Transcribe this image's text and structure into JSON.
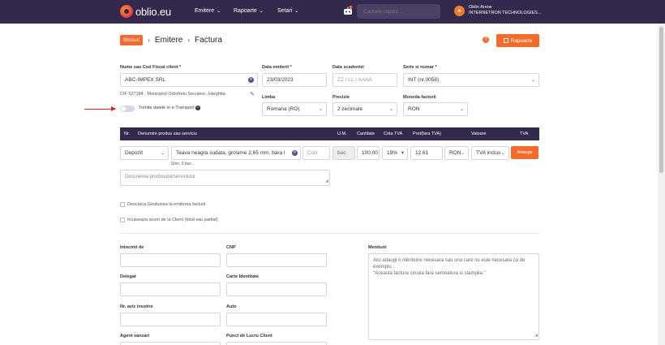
{
  "nav": {
    "logo_text": "oblio.eu",
    "menu": [
      {
        "label": "Emitere"
      },
      {
        "label": "Rapoarte"
      },
      {
        "label": "Setari"
      }
    ],
    "search_placeholder": "Cautare rapida ...",
    "user_name": "Oblio Arrow",
    "user_company": "INTERNETRON TECHNOLOGIES...",
    "avatar_icon": "user-icon"
  },
  "breadcrumb": {
    "badge": "Stocuri",
    "items": [
      "Emitere",
      "Factura"
    ]
  },
  "header_actions": {
    "rapoarte_label": "Rapoarte"
  },
  "client": {
    "label": "Nume sau Cod Fiscal client *",
    "value": "ABC-IMPEX SRL",
    "details": "CIF 527184 , Municipiul Odorheiu Secuiesc, Harghita"
  },
  "dates": {
    "emitere_label": "Data emiterii *",
    "emitere_value": "23/03/2023",
    "scadenta_label": "Data scadentei",
    "scadenta_placeholder": "ZZ / LL / AAAA"
  },
  "series": {
    "label": "Serie si numar *",
    "value": "INT (nr.0058)"
  },
  "etransport": {
    "label": "Trimite datele in e-Transport"
  },
  "language": {
    "label": "Limba",
    "value": "Romana (RO)"
  },
  "precision": {
    "label": "Precizie",
    "value": "2 zecimale"
  },
  "currency": {
    "label": "Moneda facturii",
    "value": "RON"
  },
  "products_table": {
    "headers": [
      "Nr.",
      "Denumire produs sau serviciu",
      "U.M.",
      "Cantitate",
      "Cota TVA",
      "Pret(fara TVA)",
      "Valoare",
      "TVA"
    ],
    "row": {
      "type": "Depozit",
      "name": "Teava neagra sudata, grosime 2,65 mm, bara l",
      "code_placeholder": "Cod",
      "um": "buc",
      "quantity": "100.00",
      "vat": "19%",
      "price": "12.61",
      "currency": "RON",
      "vat_mode": "TVA inclus",
      "add_label": "Adauga",
      "stock": "Stoc: 0 buc"
    },
    "description_placeholder": "Descrierea produsului/serviciului"
  },
  "options": {
    "descarca_gestiunea": "Descarca Gestiunea la emiterea facturii",
    "incaseaza": "Incaseaza acum de la Client (total sau partial)"
  },
  "details_section": {
    "intocmit_label": "Intocmit de",
    "cnp_label": "CNP",
    "delegat_label": "Delegat",
    "buletin_label": "Carte Identitate",
    "aviz_label": "Nr. aviz insotire",
    "auto_label": "Auto",
    "agent_label": "Agent vanzari",
    "punct_label": "Punct de Lucru Client",
    "mentiuni_label": "Mentiuni",
    "mentiuni_placeholder": "Aici adaugi o mentiune necesara sau una care nu este necesara ca de exemplu :\n\"Aceasta factura circula fara semnatura si stampila.\""
  },
  "colors": {
    "nav_bg": "#32294d",
    "accent": "#f26b2c",
    "arrow": "#e02222"
  }
}
